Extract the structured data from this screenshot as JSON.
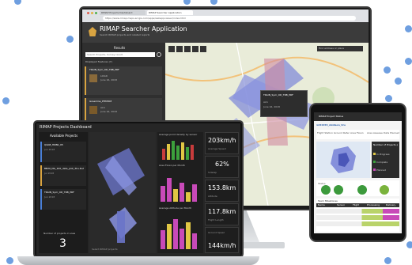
{
  "searcher": {
    "title": "RIMAP Searcher Application",
    "subtitle": "Search RIMAP projects and related reports",
    "tab1": "RIMAP Projects Dashboard",
    "tab2": "RIMAP Searcher Application",
    "url": "https://www.rimap.maps.arcgis.com/apps/webappviewer/index.html",
    "panel_title": "Results",
    "search_placeholder": "Search Projects, Survey result",
    "section_label": "Displayed Features (7)",
    "results": [
      {
        "title": "TRAIN_Sym_OD_TRB_PRF",
        "type": "LiDAR",
        "date": "June 16, 2018"
      },
      {
        "title": "Greenline_PHM308",
        "type": "ALS",
        "date": "June 16, 2018"
      },
      {
        "title": "2017REEE_V104_Standard_Glacier",
        "type": "LiDAR",
        "date": "2017"
      }
    ],
    "map_search_placeholder": "Find address or place",
    "popup": {
      "title": "TRAIN_Sym_OD_TRB_PRF",
      "type": "ALS",
      "date": "June 16, 2018"
    }
  },
  "dashboard": {
    "title": "RIMAP Projects Dashboard",
    "list_title": "Available Projects",
    "projects": [
      {
        "name": "Q4AB_HDBK_05",
        "date": "Jun 2018"
      },
      {
        "name": "BB20_NG_100_data_plot_30+4L2",
        "date": "Jul 2018"
      },
      {
        "name": "TRAIN_Sym_OD_TRB_PRF",
        "date": "Jun 2018"
      }
    ],
    "count_label": "Number of projects in view",
    "count_value": "3",
    "chart1_title": "Average point density by sensor",
    "chart2_title": "Area Flown per Month",
    "chart3_title": "Average Altitude per Month",
    "kpis": [
      {
        "value": "203km/h",
        "label": "Average Speed"
      },
      {
        "value": "62%",
        "label": "Sidelap"
      },
      {
        "value": "153.8km",
        "label": "Altitude"
      },
      {
        "value": "117.8km",
        "label": "Flight Length"
      },
      {
        "value": "144km/h",
        "label": "Ground Speed"
      }
    ],
    "map_note": "Select RIMAP projects"
  },
  "tablet": {
    "title": "RIMAP Project Status",
    "project_name": "1234455_Addison_Vro",
    "status_label": "Status",
    "kpi_labels": [
      "Flight Stations",
      "Ground Reference",
      "Area Flown",
      "Area Assessed",
      "Data Planned"
    ],
    "legend_title": "Number of Projects per Category",
    "legend_items": [
      "In Progress",
      "Complete",
      "Planned"
    ],
    "table_title": "Team Milestones",
    "columns": [
      "Name",
      "Sensor",
      "Flight",
      "Processing",
      "Delivery"
    ]
  },
  "colors": {
    "dot": "#6f9fe0",
    "accent_blue": "#4a7fd6",
    "bar_pink": "#c84ab8",
    "bar_yellow": "#e1c744",
    "bar_green": "#3ca03c",
    "bar_red": "#c83c3c"
  }
}
